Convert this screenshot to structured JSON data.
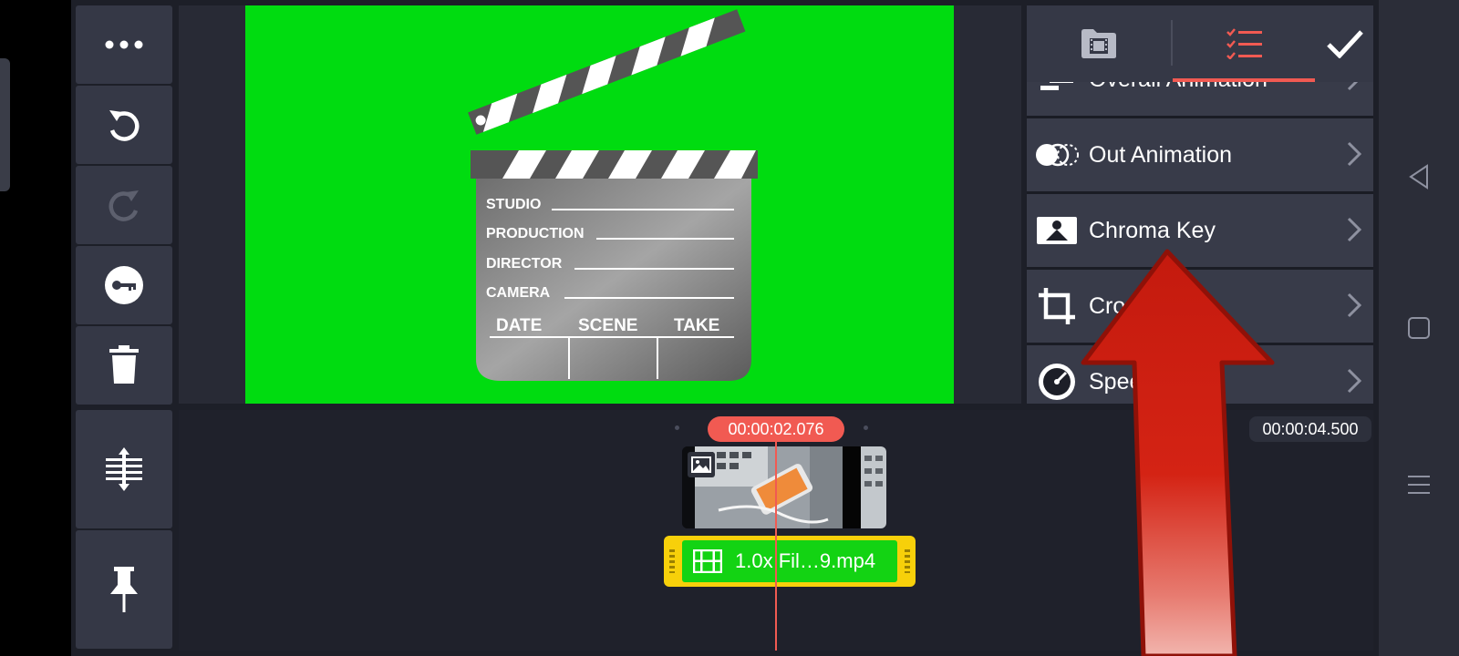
{
  "toolbar": {
    "more_icon": "more-horizontal-icon",
    "undo_icon": "undo-icon",
    "redo_icon": "redo-icon",
    "keyframe_icon": "key-icon",
    "delete_icon": "trash-icon"
  },
  "timeline_tools": {
    "expand_icon": "expand-layers-icon",
    "pin_icon": "pin-icon"
  },
  "clapperboard": {
    "rows": [
      "STUDIO",
      "PRODUCTION",
      "DIRECTOR",
      "CAMERA"
    ],
    "columns": [
      "DATE",
      "SCENE",
      "TAKE"
    ]
  },
  "panel": {
    "tabs": [
      {
        "icon": "media-folder-icon",
        "active": false
      },
      {
        "icon": "checklist-icon",
        "active": true
      }
    ],
    "confirm_icon": "checkmark-icon",
    "accent_color": "#f15a52",
    "items": [
      {
        "label": "Overall Animation",
        "icon": "overall-animation-icon"
      },
      {
        "label": "Out Animation",
        "icon": "out-animation-icon"
      },
      {
        "label": "Chroma Key",
        "icon": "chroma-key-icon"
      },
      {
        "label": "Crop",
        "icon": "crop-icon"
      },
      {
        "label": "Speed",
        "icon": "speed-icon"
      }
    ]
  },
  "timeline": {
    "current_time": "00:00:02.076",
    "total_time": "00:00:04.500",
    "clip_label": "1.0x Fil…9.mp4",
    "clip_color": "#13d313",
    "clip_border_color": "#f7d00a"
  },
  "annotation": {
    "arrow_color": "#d81e10"
  },
  "system_nav": {
    "back_icon": "back-icon",
    "home_icon": "home-icon",
    "recents_icon": "recents-icon"
  }
}
